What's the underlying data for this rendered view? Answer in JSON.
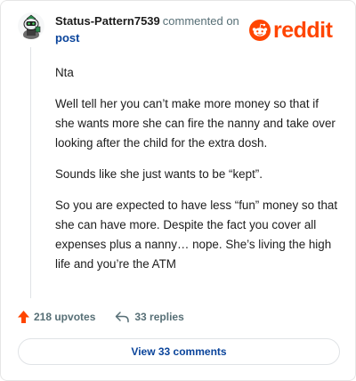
{
  "header": {
    "username": "Status-Pattern7539",
    "action_text": "commented on",
    "target_link": "post",
    "logo_text": "reddit",
    "avatar_icon": "snoo-avatar-icon",
    "logo_icon": "reddit-snoo-icon"
  },
  "comment": {
    "paragraphs": [
      "Nta",
      "Well tell her you can’t make more money so that if she wants more she can fire the nanny and take over looking after the child for the extra dosh.",
      "Sounds like she just wants to be “kept”.",
      "So you are expected to have less “fun” money so that she can have more. Despite the fact you cover all expenses plus a nanny… nope. She’s living the high life and you’re the ATM"
    ]
  },
  "actions": {
    "upvotes": "218 upvotes",
    "replies": "33 replies",
    "upvote_icon": "upvote-arrow-icon",
    "reply_icon": "reply-arrow-icon"
  },
  "footer": {
    "view_comments": "View 33 comments"
  },
  "colors": {
    "brand": "#ff4500",
    "link": "#0a449b",
    "meta": "#576f76",
    "text": "#1c1c1c",
    "border": "#e0e3e6"
  }
}
